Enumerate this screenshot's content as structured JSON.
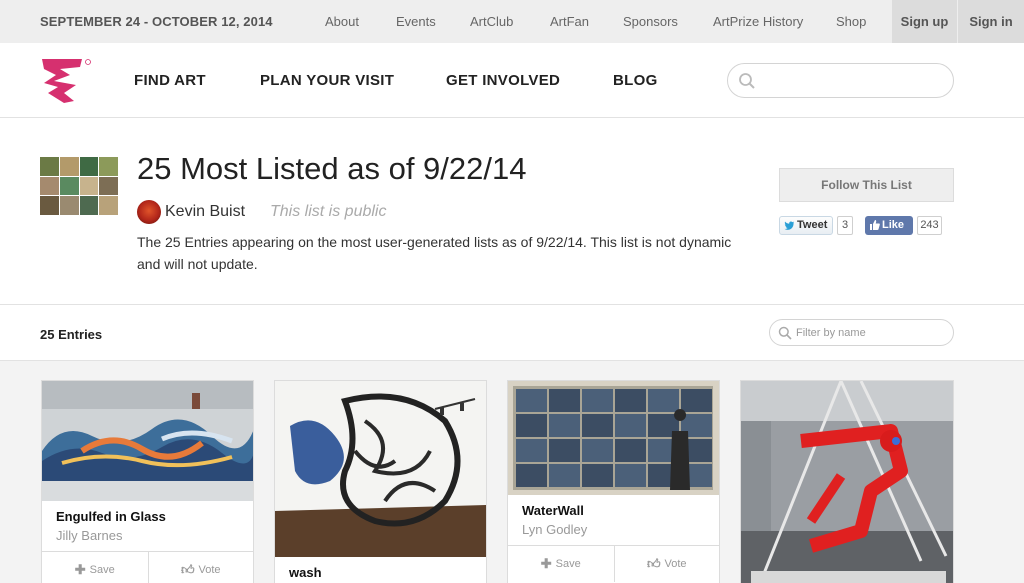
{
  "topbar": {
    "dates": "SEPTEMBER 24 - OCTOBER 12, 2014",
    "links": [
      "About",
      "Events",
      "ArtClub",
      "ArtFan",
      "Sponsors",
      "ArtPrize History",
      "Shop"
    ],
    "sign_up": "Sign up",
    "sign_in": "Sign in"
  },
  "header": {
    "nav": [
      "FIND ART",
      "PLAN YOUR VISIT",
      "GET INVOLVED",
      "BLOG"
    ],
    "search_placeholder": ""
  },
  "list": {
    "title": "25 Most Listed as of 9/22/14",
    "author": "Kevin Buist",
    "visibility": "This list is public",
    "description": "The 25 Entries appearing on the most user-generated lists as of 9/22/14. This list is not dynamic and will not update.",
    "follow_label": "Follow This List",
    "tweet_label": "Tweet",
    "tweet_count": "3",
    "like_label": "Like",
    "like_count": "243"
  },
  "entries": {
    "count_label": "25 Entries",
    "filter_placeholder": "Filter by name",
    "save_label": "Save",
    "vote_label": "Vote",
    "cards": [
      {
        "title": "Engulfed in Glass",
        "artist": "Jilly Barnes"
      },
      {
        "title": "wash",
        "artist": ""
      },
      {
        "title": "WaterWall",
        "artist": "Lyn Godley"
      },
      {
        "title": "",
        "artist": ""
      }
    ]
  },
  "colors": {
    "brand": "#d6306f",
    "topbar_bg": "#eeeeee",
    "account_bg": "#dcdcdc",
    "facebook": "#5f78ab"
  }
}
